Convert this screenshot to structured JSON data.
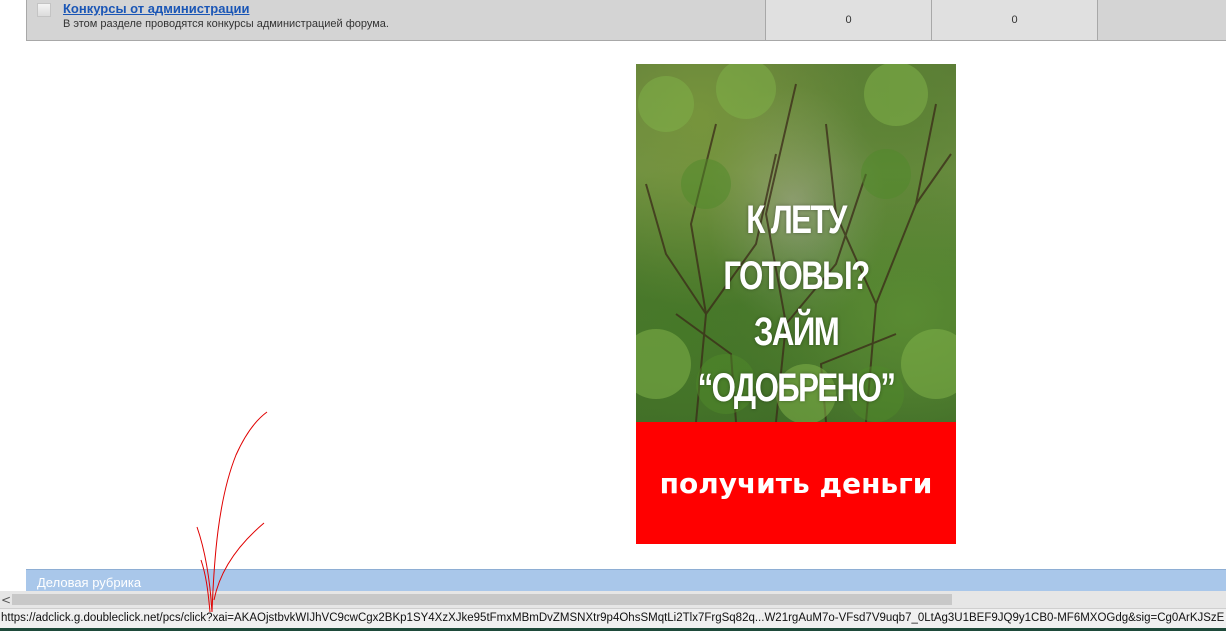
{
  "forum": {
    "title": "Конкурсы от администрации",
    "description": "В этом разделе проводятся конкурсы администрацией форума.",
    "topics": "0",
    "posts": "0"
  },
  "ad": {
    "headline_line1": "К ЛЕТУ ГОТОВЫ?",
    "headline_line2": "ЗАЙМ “ОДОБРЕНО”",
    "cta_label": "получить деньги",
    "cta_color": "#ff0000"
  },
  "section": {
    "label": "Деловая рубрика"
  },
  "scrollbar": {
    "left_arrow": "<"
  },
  "status": {
    "url": "https://adclick.g.doubleclick.net/pcs/click?xai=AKAOjstbvkWIJhVC9cwCgx2BKp1SY4XzXJke95tFmxMBmDvZMSNXtr9p4OhsSMqtLi2Tlx7FrgSq82q...W21rgAuM7o-VFsd7V9uqb7_0LtAg3U1BEF9JQ9y1CB0-MF6MXOGdg&sig=Cg0ArKJSzE"
  },
  "colors": {
    "link": "#1a56b6",
    "section_bar": "#a9c7ea",
    "annotation": "#e00000"
  }
}
